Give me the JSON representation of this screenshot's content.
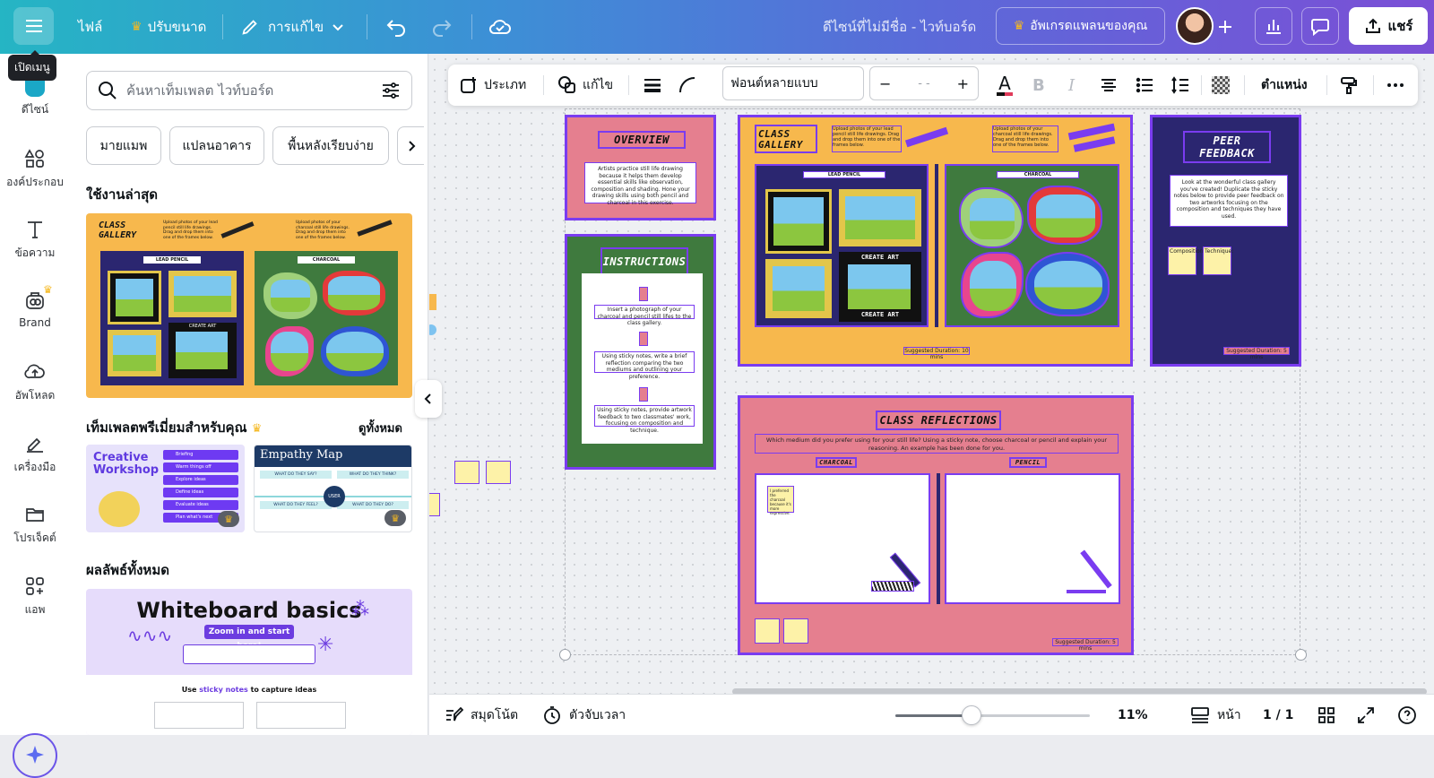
{
  "topbar": {
    "menu_tooltip": "เปิดเมนู",
    "file": "ไฟล์",
    "resize": "ปรับขนาด",
    "edit": "การแก้ไข",
    "doc_title": "ดีไซน์ที่ไม่มีชื่อ - ไวท์บอร์ด",
    "upgrade": "อัพเกรดแพลนของคุณ",
    "share": "แชร์",
    "accent": "#f5b820"
  },
  "rail": [
    {
      "label": "ดีไซน์",
      "icon": "design-icon"
    },
    {
      "label": "องค์ประกอบ",
      "icon": "elements-icon"
    },
    {
      "label": "ข้อความ",
      "icon": "text-icon"
    },
    {
      "label": "Brand",
      "icon": "brand-icon"
    },
    {
      "label": "อัพโหลด",
      "icon": "upload-icon"
    },
    {
      "label": "เครื่องมือ",
      "icon": "draw-icon"
    },
    {
      "label": "โปรเจ็คต์",
      "icon": "folder-icon"
    },
    {
      "label": "แอพ",
      "icon": "apps-icon"
    }
  ],
  "panel": {
    "search_placeholder": "ค้นหาเท็มเพลต ไวท์บอร์ด",
    "chips": [
      "มายแมพ",
      "แปลนอาคาร",
      "พื้นหลังเรียบง่าย"
    ],
    "recent_title": "ใช้งานล่าสุด",
    "premium_title": "เท็มเพลตพรีเมี่ยมสำหรับคุณ",
    "see_all": "ดูทั้งหมด",
    "all_results_title": "ผลลัพธ์ทั้งหมด",
    "recent_thumb": {
      "title": "CLASS GALLERY",
      "note1": "Upload photos of your lead pencil still life drawings. Drag and drop them into one of the frames below.",
      "note2": "Upload photos of your charcoal still life drawings. Drag and drop them into one of the frames below.",
      "label1": "LEAD PENCIL",
      "label2": "CHARCOAL",
      "create_art": "CREATE ART"
    },
    "template1": {
      "title": "Creative Workshop",
      "steps": [
        "Briefing",
        "Warm things off",
        "Explore ideas",
        "Define ideas",
        "Evaluate ideas",
        "Plan what's next"
      ]
    },
    "template2": {
      "title": "Empathy Map",
      "q1": "WHAT DO THEY SAY?",
      "q2": "WHAT DO THEY THINK?",
      "q3": "WHAT DO THEY FEEL?",
      "q4": "WHAT DO THEY DO?",
      "center": "USER"
    },
    "result1": {
      "title": "Whiteboard basics",
      "pill": "Zoom in and start here!",
      "tagline_pre": "Use ",
      "tagline_em": "sticky notes",
      "tagline_post": " to capture ideas"
    }
  },
  "toolbar": {
    "type": "ประเภท",
    "edit": "แก้ไข",
    "font": "ฟอนต์หลายแบบ",
    "size": "- -",
    "position": "ตำแหน่ง"
  },
  "board": {
    "overview_title": "OVERVIEW",
    "overview_text": "Artists practice still life drawing because it helps them develop essential skills like observation, composition and shading. Hone your drawing skills using both pencil and charcoal in this exercise.",
    "instructions_title": "INSTRUCTIONS",
    "step1": "Insert a photograph of your charcoal and pencil still lifes to the class gallery.",
    "step2": "Using sticky notes, write a brief reflection comparing the two mediums and outlining your preference.",
    "step3": "Using sticky notes, provide artwork feedback to two classmates' work, focusing on composition and technique.",
    "gallery_title": "CLASS GALLERY",
    "gallery_note1": "Upload photos of your lead pencil still life drawings. Drag and drop them into one of the frames below.",
    "gallery_note2": "Upload photos of your charcoal still life drawings. Drag and drop them into one of the frames below.",
    "lead_pencil": "LEAD PENCIL",
    "charcoal": "CHARCOAL",
    "create_art": "CREATE ART",
    "duration1": "Suggested Duration: 10 mins",
    "peer_title": "PEER FEEDBACK",
    "peer_text": "Look at the wonderful class gallery you've created! Duplicate the sticky notes below to provide peer feedback on two artworks focusing on the composition and techniques they have used.",
    "peer_sticky1": "Composition:",
    "peer_sticky2": "Technique:",
    "duration2": "Suggested Duration: 5 mins",
    "reflect_title": "CLASS REFLECTIONS",
    "reflect_text": "Which medium did you prefer using for your still life? Using a sticky note, choose charcoal or pencil and explain your reasoning. An example has been done for you.",
    "reflect_charcoal": "CHARCOAL",
    "reflect_pencil": "PENCIL",
    "reflect_example": "I preferred the charcoal because it's more expressive.",
    "duration3": "Suggested Duration: 5 mins"
  },
  "bottombar": {
    "notes": "สมุดโน้ต",
    "timer": "ตัวจับเวลา",
    "zoom": "11%",
    "zoom_level": 0.39,
    "pages": "หน้า",
    "page_count": "1 / 1"
  }
}
